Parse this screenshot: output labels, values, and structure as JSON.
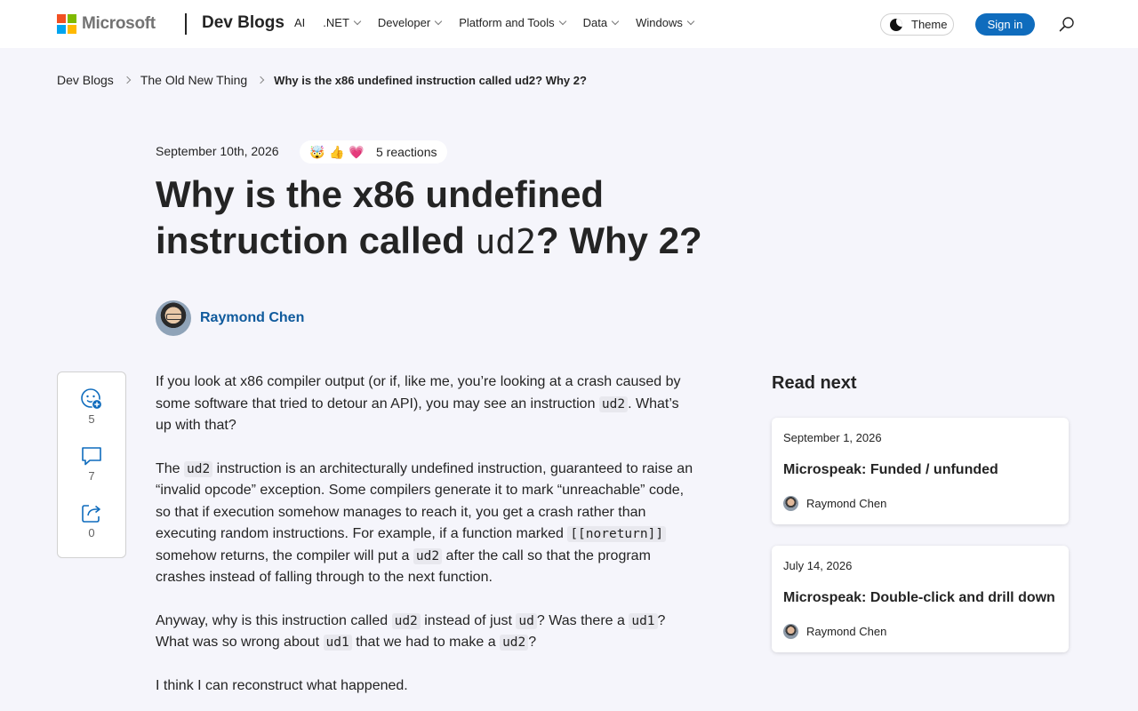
{
  "header": {
    "brand": "Microsoft",
    "site_name": "Dev Blogs",
    "nav": [
      {
        "label": "AI",
        "has_dropdown": false
      },
      {
        "label": ".NET",
        "has_dropdown": true
      },
      {
        "label": "Developer",
        "has_dropdown": true
      },
      {
        "label": "Platform and Tools",
        "has_dropdown": true
      },
      {
        "label": "Data",
        "has_dropdown": true
      },
      {
        "label": "Windows",
        "has_dropdown": true
      }
    ],
    "theme_label": "Theme",
    "signin_label": "Sign in",
    "search_icon": "search-icon"
  },
  "breadcrumb": {
    "items": [
      "Dev Blogs",
      "The Old New Thing"
    ],
    "current": "Why is the x86 undefined instruction called ud2? Why 2?"
  },
  "post": {
    "date": "September 10th, 2026",
    "reactions_emojis": [
      "🤯",
      "👍",
      "💗"
    ],
    "reactions_label": "5 reactions",
    "title_part1": "Why is the x86 undefined instruction called ",
    "title_code": "ud2",
    "title_part2": "? Why 2?",
    "author": "Raymond Chen"
  },
  "actions": {
    "reactions_count": "5",
    "comments_count": "7",
    "shares_count": "0"
  },
  "article": {
    "p1": {
      "a": "If you look at x86 compiler output (or if, like me, you’re looking at a crash caused by some software that tried to detour an API), you may see an instruction ",
      "code1": "ud2",
      "b": ". What’s up with that?"
    },
    "p2": {
      "a": "The ",
      "code1": "ud2",
      "b": " instruction is an architecturally undefined instruction, guaranteed to raise an “invalid opcode” exception. Some compilers generate it to mark “unreachable” code, so that if execution somehow manages to reach it, you get a crash rather than executing random instructions. For example, if a function marked ",
      "code2": "[[noreturn]]",
      "c": " somehow returns, the compiler will put a ",
      "code3": "ud2",
      "d": " after the call so that the program crashes instead of falling through to the next function."
    },
    "p3": {
      "a": "Anyway, why is this instruction called ",
      "code1": "ud2",
      "b": " instead of just ",
      "code2": "ud",
      "c": "? Was there a ",
      "code3": "ud1",
      "d": "? What was so wrong about ",
      "code4": "ud1",
      "e": " that we had to make a ",
      "code5": "ud2",
      "f": "?"
    },
    "p4": "I think I can reconstruct what happened."
  },
  "read_next": {
    "heading": "Read next",
    "cards": [
      {
        "date": "September 1, 2026",
        "title": "Microspeak: Funded / unfunded",
        "author": "Raymond Chen"
      },
      {
        "date": "July 14, 2026",
        "title": "Microspeak: Double-click and drill down",
        "author": "Raymond Chen"
      }
    ]
  },
  "colors": {
    "accent": "#0f6cbd",
    "author_link": "#0f5a9c",
    "page_bg": "#f5f5fb",
    "ms_red": "#f25022",
    "ms_green": "#7fba00",
    "ms_blue": "#00a4ef",
    "ms_yellow": "#ffb900"
  }
}
